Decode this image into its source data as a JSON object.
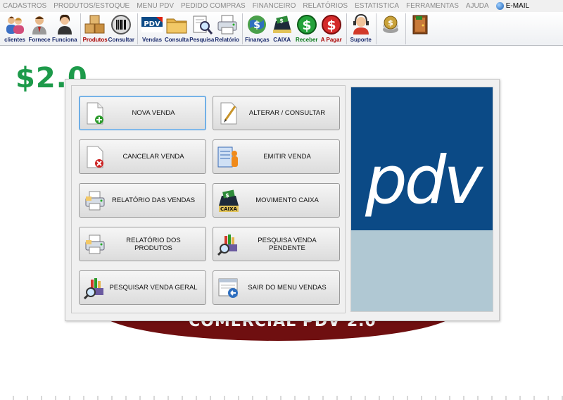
{
  "menu": {
    "items": [
      "CADASTROS",
      "PRODUTOS/ESTOQUE",
      "MENU PDV",
      "PEDIDO COMPRAS",
      "FINANCEIRO",
      "RELATÓRIOS",
      "ESTATISTICA",
      "FERRAMENTAS",
      "AJUDA"
    ],
    "email": "E-MAIL"
  },
  "toolbar": {
    "clientes": "clientes",
    "fornece": "Fornece",
    "funciona": "Funciona",
    "produtos": "Produtos",
    "consultar": "Consultar",
    "vendas": "Vendas",
    "consulta": "Consulta",
    "pesquisa": "Pesquisa",
    "relatorio": "Relatório",
    "financas": "Finanças",
    "caixa": "CAIXA",
    "receber": "Receber",
    "apagar": "A Pagar",
    "suporte": "Suporte",
    "pdv_icon_text": "PDV"
  },
  "background": {
    "logo_text": "$2.0",
    "banner_text": "COMERCIAL PDV 2.0"
  },
  "buttons": {
    "nova_venda": "NOVA VENDA",
    "alterar_consultar": "ALTERAR / CONSULTAR",
    "cancelar_venda": "CANCELAR VENDA",
    "emitir_venda": "EMITIR VENDA",
    "relatorio_vendas": "RELATÓRIO DAS VENDAS",
    "movimento_caixa": "MOVIMENTO CAIXA",
    "relatorio_produtos": "RELATÓRIO DOS PRODUTOS",
    "pesquisa_pendente": "PESQUISA VENDA PENDENTE",
    "pesquisar_geral": "PESQUISAR VENDA GERAL",
    "sair_menu": "SAIR DO MENU VENDAS",
    "caixa_icon_label": "CAIXA"
  },
  "logo": {
    "text": "pdv"
  },
  "colors": {
    "pdv_blue": "#0b4a86",
    "pdv_light": "#b0c8d3",
    "banner_red": "#6f0f10",
    "logo_green": "#1d9a4a"
  }
}
